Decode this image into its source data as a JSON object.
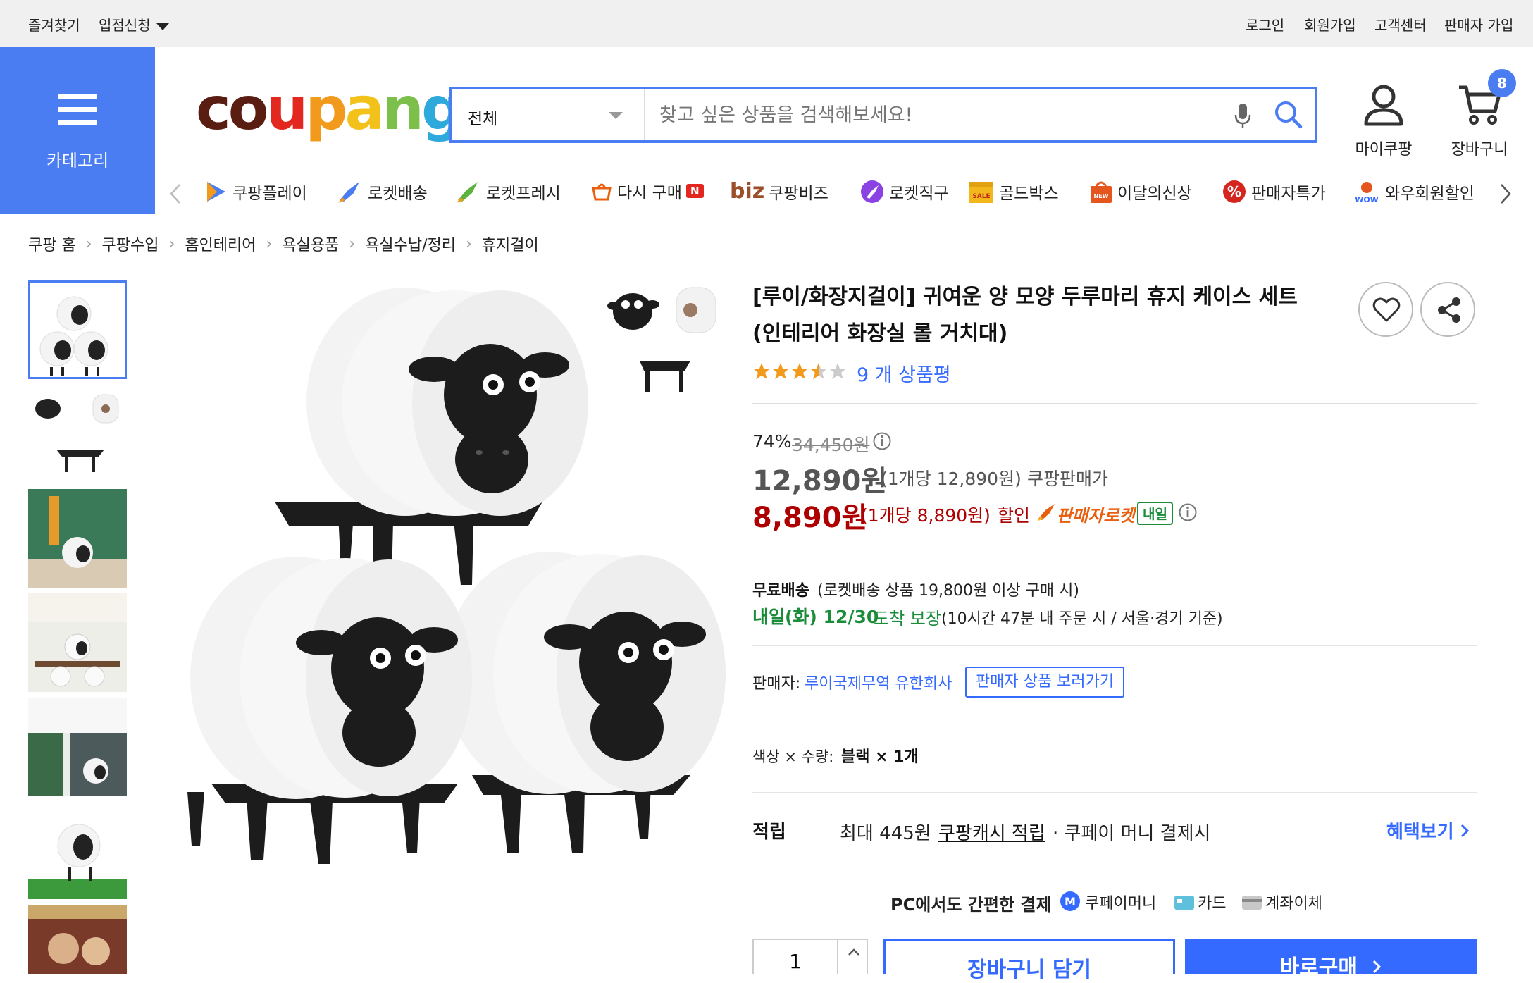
{
  "topbar": {
    "left": [
      "즐겨찾기",
      "입점신청"
    ],
    "right": [
      "로그인",
      "회원가입",
      "고객센터",
      "판매자 가입"
    ]
  },
  "category": {
    "label": "카테고리"
  },
  "logo": {
    "text": "coupang"
  },
  "search": {
    "category": "전체",
    "placeholder": "찾고 싶은 상품을 검색해보세요!"
  },
  "user": {
    "my_label": "마이쿠팡",
    "cart_label": "장바구니",
    "cart_count": "8"
  },
  "nav": {
    "items": [
      {
        "label": "쿠팡플레이",
        "icon": "coupang-play-icon"
      },
      {
        "label": "로켓배송",
        "icon": "rocket-icon"
      },
      {
        "label": "로켓프레시",
        "icon": "rocket-fresh-icon"
      },
      {
        "label": "다시 구매",
        "icon": "rebuy-icon",
        "badge": "N"
      },
      {
        "label": "쿠팡비즈",
        "icon": "biz-icon",
        "prefix": "biz"
      },
      {
        "label": "로켓직구",
        "icon": "rocket-direct-icon"
      },
      {
        "label": "골드박스",
        "icon": "goldbox-icon"
      },
      {
        "label": "이달의신상",
        "icon": "new-bag-icon"
      },
      {
        "label": "판매자특가",
        "icon": "percent-icon"
      },
      {
        "label": "와우회원할인",
        "icon": "wow-icon"
      }
    ]
  },
  "breadcrumb": [
    "쿠팡 홈",
    "쿠팡수입",
    "홈인테리어",
    "욕실용품",
    "욕실수납/정리",
    "휴지걸이"
  ],
  "product": {
    "title": "[루이/화장지걸이] 귀여운 양 모양 두루마리 휴지 케이스 세트 (인테리어 화장실 롤 거치대)",
    "rating": 3.5,
    "review_count": "9 개 상품평",
    "discount_rate": "74%",
    "original_price": "34,450원",
    "sale_price": "12,890원",
    "sale_unit": "(1개당 12,890원)",
    "sale_label": "쿠팡판매가",
    "coupon_price": "8,890원",
    "coupon_unit": "(1개당 8,890원)",
    "coupon_label": "할인",
    "seller_rocket": "판매자로켓",
    "tomorrow_badge": "내일",
    "shipping_title": "무료배송",
    "shipping_cond": "(로켓배송 상품 19,800원 이상 구매 시)",
    "arrival": "내일(화) 12/30",
    "arrival_guarantee": "도착 보장",
    "arrival_cond": "(10시간 47분 내 주문 시 / 서울·경기 기준)",
    "seller_label": "판매자:",
    "seller_name": "루이국제무역 유한회사",
    "seller_link": "판매자 상품 보러가기",
    "option_label": "색상 × 수량:",
    "option_value": "블랙 × 1개",
    "reward_label": "적립",
    "reward_max": "최대 445원",
    "reward_cash": "쿠팡캐시 적립",
    "reward_cond": "· 쿠페이 머니 결제시",
    "benefit_link": "혜택보기",
    "pay_title": "PC에서도 간편한 결제",
    "pay_methods": [
      "쿠페이머니",
      "카드",
      "계좌이체"
    ],
    "quantity": "1",
    "cart_button": "장바구니 담기",
    "buy_button": "바로구매"
  },
  "colors": {
    "accent": "#4a7df2",
    "link": "#346aff",
    "price_red": "#ae0000",
    "green": "#1a8c3a",
    "rocket_orange": "#e8600d"
  }
}
